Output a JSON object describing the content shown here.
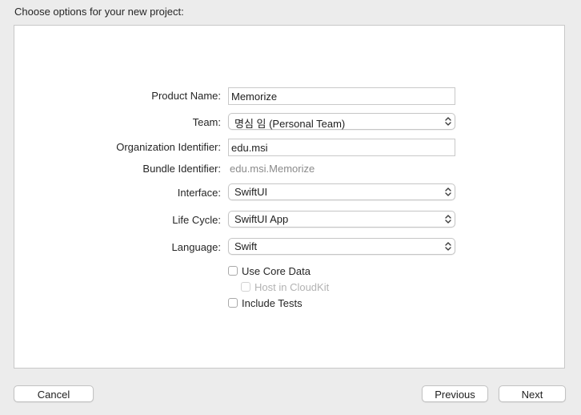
{
  "header": {
    "title": "Choose options for your new project:"
  },
  "form": {
    "product_name": {
      "label": "Product Name:",
      "value": "Memorize"
    },
    "team": {
      "label": "Team:",
      "value": "명심 임 (Personal Team)"
    },
    "organization_identifier": {
      "label": "Organization Identifier:",
      "value": "edu.msi"
    },
    "bundle_identifier": {
      "label": "Bundle Identifier:",
      "value": "edu.msi.Memorize"
    },
    "interface": {
      "label": "Interface:",
      "value": "SwiftUI"
    },
    "life_cycle": {
      "label": "Life Cycle:",
      "value": "SwiftUI App"
    },
    "language": {
      "label": "Language:",
      "value": "Swift"
    },
    "checkboxes": {
      "use_core_data": {
        "label": "Use Core Data",
        "checked": false
      },
      "host_in_cloudkit": {
        "label": "Host in CloudKit",
        "checked": false,
        "disabled": true
      },
      "include_tests": {
        "label": "Include Tests",
        "checked": false
      }
    }
  },
  "footer": {
    "cancel_label": "Cancel",
    "previous_label": "Previous",
    "next_label": "Next"
  },
  "icons": {
    "popup_indicator": "chevron-up-down-icon"
  }
}
